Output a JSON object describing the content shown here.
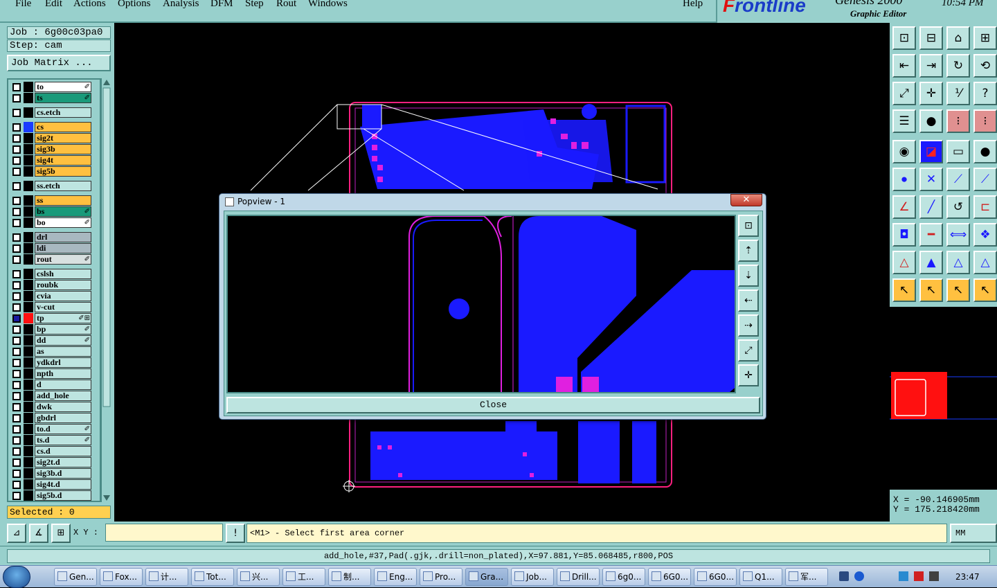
{
  "menu": [
    "File",
    "Edit",
    "Actions",
    "Options",
    "Analysis",
    "DFM",
    "Step",
    "Rout",
    "Windows",
    "Help"
  ],
  "brand": {
    "logo_a": "F",
    "logo_b": "rontline",
    "product": "Genesis 2000",
    "subtitle": "Graphic Editor",
    "time": "10:54 PM"
  },
  "job": {
    "job_label": "Job : 6g00c03pa0",
    "step_label": "Step: cam",
    "matrix_button": "Job Matrix ..."
  },
  "layers": [
    {
      "name": "to",
      "color": "#ffffff",
      "swatch": "#000000",
      "marker": "✐"
    },
    {
      "name": "ts",
      "color": "#1a9a7a",
      "swatch": "#000000",
      "marker": "✐"
    },
    {
      "name": "cs.etch",
      "color": "#bde4e0",
      "swatch": "#000000",
      "marker": ""
    },
    {
      "name": "cs",
      "color": "#ffc040",
      "swatch": "#1a3cff",
      "marker": ""
    },
    {
      "name": "sig2t",
      "color": "#ffc040",
      "swatch": "#000000",
      "marker": ""
    },
    {
      "name": "sig3b",
      "color": "#ffc040",
      "swatch": "#000000",
      "marker": ""
    },
    {
      "name": "sig4t",
      "color": "#ffc040",
      "swatch": "#000000",
      "marker": ""
    },
    {
      "name": "sig5b",
      "color": "#ffc040",
      "swatch": "#000000",
      "marker": ""
    },
    {
      "name": "ss.etch",
      "color": "#bde4e0",
      "swatch": "#000000",
      "marker": ""
    },
    {
      "name": "ss",
      "color": "#ffc040",
      "swatch": "#000000",
      "marker": ""
    },
    {
      "name": "bs",
      "color": "#1a9a7a",
      "swatch": "#000000",
      "marker": "✐"
    },
    {
      "name": "bo",
      "color": "#ffffff",
      "swatch": "#000000",
      "marker": "✐"
    },
    {
      "name": "drl",
      "color": "#a8b8c0",
      "swatch": "#000000",
      "marker": ""
    },
    {
      "name": "ldi",
      "color": "#a8b8c0",
      "swatch": "#000000",
      "marker": ""
    },
    {
      "name": "rout",
      "color": "#d8e0e0",
      "swatch": "#000000",
      "marker": "✐"
    },
    {
      "name": "cslsh",
      "color": "#bde4e0",
      "swatch": "#000000",
      "marker": ""
    },
    {
      "name": "roubk",
      "color": "#bde4e0",
      "swatch": "#000000",
      "marker": ""
    },
    {
      "name": "cvia",
      "color": "#bde4e0",
      "swatch": "#000000",
      "marker": ""
    },
    {
      "name": "v-cut",
      "color": "#bde4e0",
      "swatch": "#000000",
      "marker": ""
    },
    {
      "name": "tp",
      "color": "#bde4e0",
      "swatch": "#ff1010",
      "marker": "✐⊞"
    },
    {
      "name": "bp",
      "color": "#bde4e0",
      "swatch": "#000000",
      "marker": "✐"
    },
    {
      "name": "dd",
      "color": "#bde4e0",
      "swatch": "#000000",
      "marker": "✐"
    },
    {
      "name": "as",
      "color": "#bde4e0",
      "swatch": "#000000",
      "marker": ""
    },
    {
      "name": "ydkdrl",
      "color": "#bde4e0",
      "swatch": "#000000",
      "marker": ""
    },
    {
      "name": "npth",
      "color": "#bde4e0",
      "swatch": "#000000",
      "marker": ""
    },
    {
      "name": "d",
      "color": "#bde4e0",
      "swatch": "#000000",
      "marker": ""
    },
    {
      "name": "add_hole",
      "color": "#bde4e0",
      "swatch": "#000000",
      "marker": ""
    },
    {
      "name": "dwk",
      "color": "#bde4e0",
      "swatch": "#000000",
      "marker": ""
    },
    {
      "name": "gbdrl",
      "color": "#bde4e0",
      "swatch": "#000000",
      "marker": ""
    },
    {
      "name": "to.d",
      "color": "#bde4e0",
      "swatch": "#000000",
      "marker": "✐"
    },
    {
      "name": "ts.d",
      "color": "#bde4e0",
      "swatch": "#000000",
      "marker": "✐"
    },
    {
      "name": "cs.d",
      "color": "#bde4e0",
      "swatch": "#000000",
      "marker": ""
    },
    {
      "name": "sig2t.d",
      "color": "#bde4e0",
      "swatch": "#000000",
      "marker": ""
    },
    {
      "name": "sig3b.d",
      "color": "#bde4e0",
      "swatch": "#000000",
      "marker": ""
    },
    {
      "name": "sig4t.d",
      "color": "#bde4e0",
      "swatch": "#000000",
      "marker": ""
    },
    {
      "name": "sig5b.d",
      "color": "#bde4e0",
      "swatch": "#000000",
      "marker": ""
    }
  ],
  "selected": "Selected : 0",
  "popup": {
    "title": "Popview - 1",
    "close_x": "✕",
    "close_button": "Close"
  },
  "coords": {
    "x": "X = -90.146905mm",
    "y": "Y = 175.218420mm"
  },
  "xy_label": "X Y :",
  "xy_value": "",
  "message": "<M1> - Select first area corner",
  "units": "MM",
  "status_line": "add_hole,#37,Pad(.gjk,.drill=non_plated),X=97.881,Y=85.068485,r800,POS",
  "taskbar": {
    "items": [
      "Gen...",
      "Fox...",
      "计...",
      "Tot...",
      "兴...",
      "工...",
      "制...",
      "Eng...",
      "Pro...",
      "Gra...",
      "Job...",
      "Drill...",
      "6g0...",
      "6G0...",
      "6G0...",
      "Q1...",
      "军..."
    ],
    "clock": "23:47"
  },
  "colors": {
    "panel": "#98d0cc",
    "copper": "#1a1aff",
    "pad": "#e020e0",
    "outline": "#ff2080"
  }
}
